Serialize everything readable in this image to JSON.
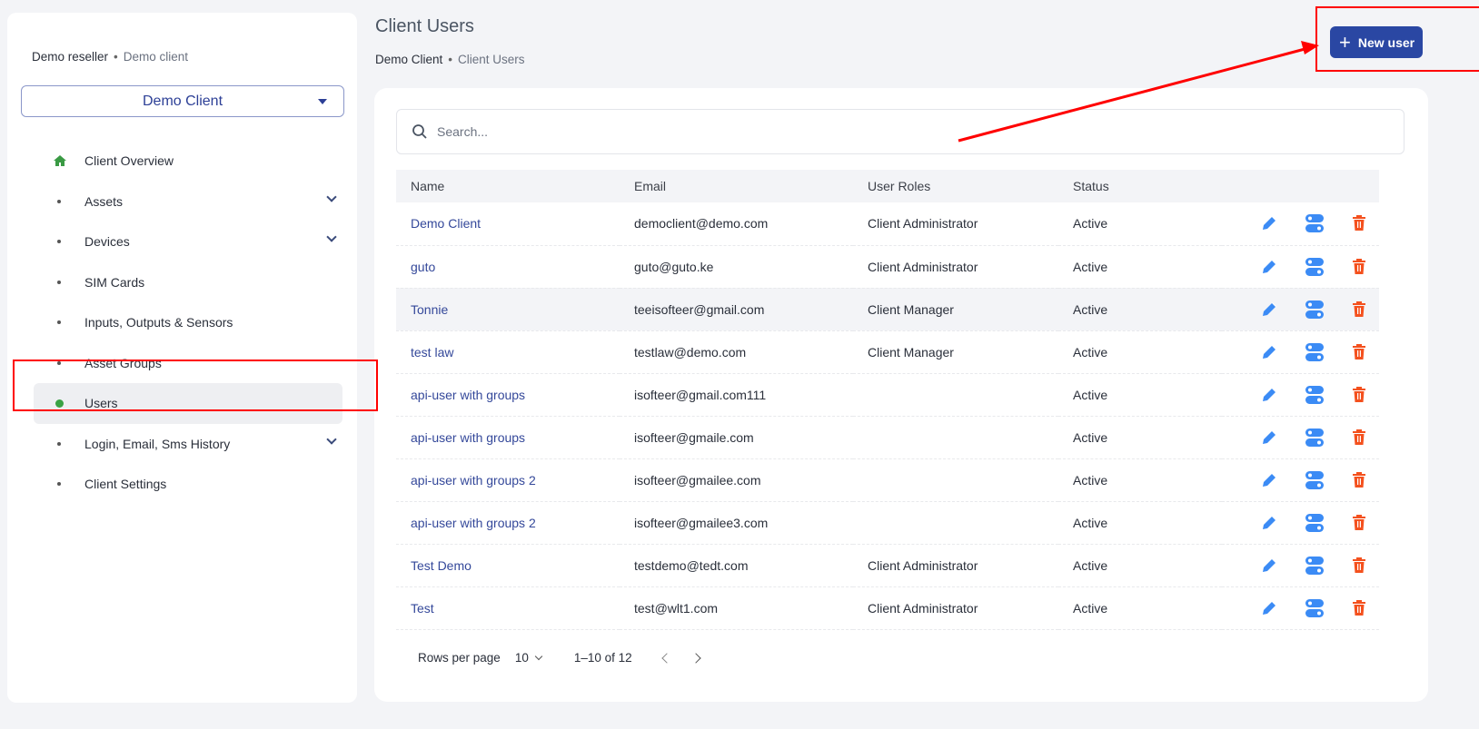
{
  "sidebar": {
    "breadcrumb": {
      "parent": "Demo reseller",
      "current": "Demo client"
    },
    "client_select": "Demo Client",
    "items": [
      {
        "label": "Client Overview"
      },
      {
        "label": "Assets"
      },
      {
        "label": "Devices"
      },
      {
        "label": "SIM Cards"
      },
      {
        "label": "Inputs, Outputs & Sensors"
      },
      {
        "label": "Asset Groups"
      },
      {
        "label": "Users"
      },
      {
        "label": "Login, Email, Sms History"
      },
      {
        "label": "Client Settings"
      }
    ]
  },
  "header": {
    "title": "Client Users",
    "breadcrumb": {
      "parent": "Demo Client",
      "current": "Client Users"
    },
    "new_user_label": "New user"
  },
  "search": {
    "placeholder": "Search..."
  },
  "table": {
    "columns": [
      "Name",
      "Email",
      "User Roles",
      "Status"
    ],
    "rows": [
      [
        "Demo Client",
        "democlient@demo.com",
        "Client Administrator",
        "Active"
      ],
      [
        "guto",
        "guto@guto.ke",
        "Client Administrator",
        "Active"
      ],
      [
        "Tonnie",
        "teeisofteer@gmail.com",
        "Client Manager",
        "Active"
      ],
      [
        "test law",
        "testlaw@demo.com",
        "Client Manager",
        "Active"
      ],
      [
        "api-user with groups",
        "isofteer@gmail.com111",
        "",
        "Active"
      ],
      [
        "api-user with groups",
        "isofteer@gmaile.com",
        "",
        "Active"
      ],
      [
        "api-user with groups 2",
        "isofteer@gmailee.com",
        "",
        "Active"
      ],
      [
        "api-user with groups 2",
        "isofteer@gmailee3.com",
        "",
        "Active"
      ],
      [
        "Test Demo",
        "testdemo@tedt.com",
        "Client Administrator",
        "Active"
      ],
      [
        "Test",
        "test@wlt1.com",
        "Client Administrator",
        "Active"
      ]
    ]
  },
  "pagination": {
    "rows_per_page_label": "Rows per page",
    "rows_per_page": "10",
    "range": "1–10 of 12"
  },
  "colors": {
    "primary": "#2a47a3",
    "edit": "#3b8bf5",
    "delete": "#f4511e",
    "active_dot": "#3aa244",
    "annotation": "#ff0000"
  }
}
